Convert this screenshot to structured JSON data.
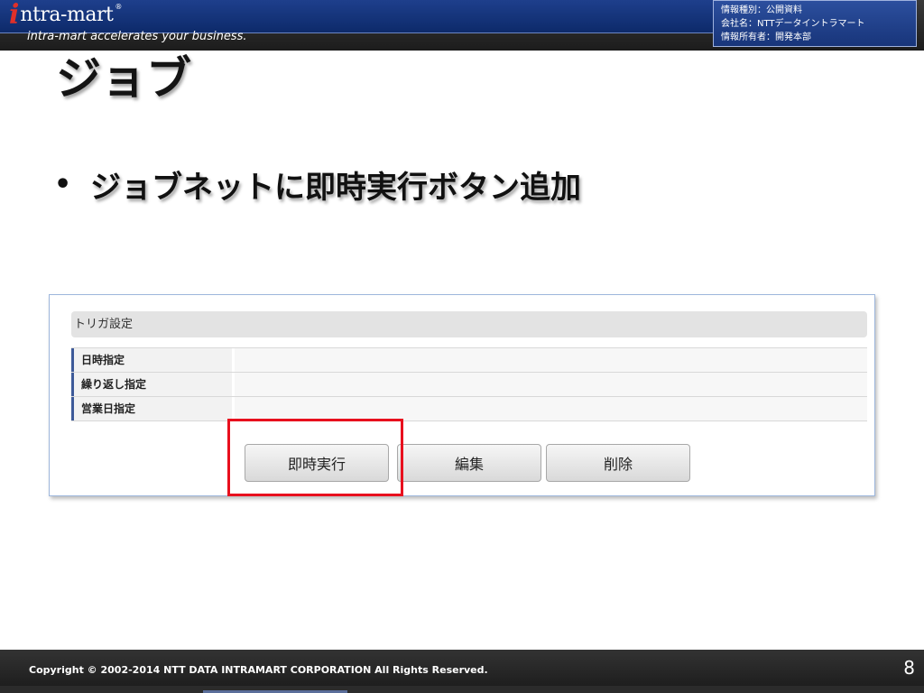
{
  "header": {
    "logo_initial": "i",
    "logo_text": "ntra-mart",
    "logo_reg": "®",
    "tagline": "intra-mart accelerates your business.",
    "info_lines": [
      "情報種別：公開資料",
      "会社名：NTTデータイントラマート",
      "情報所有者：開発本部"
    ]
  },
  "slide": {
    "title": "ジョブ",
    "bullet_symbol": "•",
    "bullet_text": "ジョブネットに即時実行ボタン追加"
  },
  "panel": {
    "section_title": "トリガ設定",
    "rows": [
      {
        "label": "日時指定"
      },
      {
        "label": "繰り返し指定"
      },
      {
        "label": "営業日指定"
      }
    ],
    "buttons": {
      "run": "即時実行",
      "edit": "編集",
      "delete": "削除"
    },
    "highlight_color": "#e8101e"
  },
  "footer": {
    "copyright": "Copyright © 2002-2014 NTT DATA INTRAMART CORPORATION All Rights Reserved.",
    "page_number": "8"
  }
}
